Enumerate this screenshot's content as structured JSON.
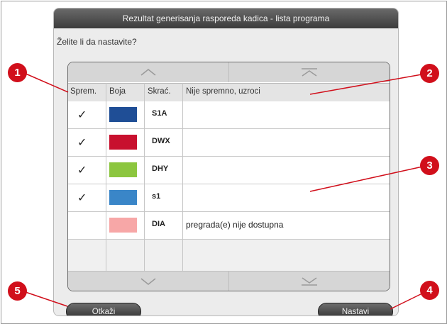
{
  "dialog": {
    "title": "Rezultat generisanja rasporeda kadica - lista programa",
    "question": "Želite li da nastavite?"
  },
  "table": {
    "columns": [
      "Sprem.",
      "Boja",
      "Skrać.",
      "Nije spremno, uzroci"
    ],
    "rows": [
      {
        "ready": "✓",
        "color": "#1f4e96",
        "abbr": "S1A",
        "reason": ""
      },
      {
        "ready": "✓",
        "color": "#c8102e",
        "abbr": "DWX",
        "reason": ""
      },
      {
        "ready": "✓",
        "color": "#8cc63f",
        "abbr": "DHY",
        "reason": ""
      },
      {
        "ready": "✓",
        "color": "#3a86c8",
        "abbr": "s1",
        "reason": ""
      },
      {
        "ready": "",
        "color": "#f7a7a7",
        "abbr": "DIA",
        "reason": "pregrada(e) nije dostupna"
      }
    ]
  },
  "buttons": {
    "cancel": "Otkaži",
    "continue": "Nastavi"
  },
  "callouts": [
    "1",
    "2",
    "3",
    "4",
    "5"
  ],
  "colors": {
    "callout": "#d10f1b",
    "titlebar": "#4a4a4a"
  }
}
